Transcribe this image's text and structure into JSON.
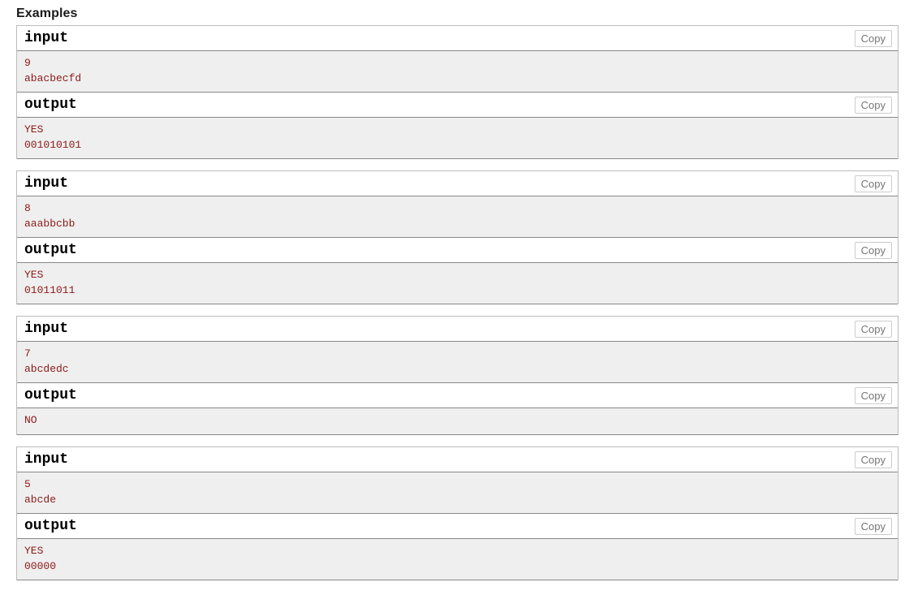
{
  "section": {
    "title": "Examples"
  },
  "labels": {
    "input": "input",
    "output": "output",
    "copy": "Copy"
  },
  "colors": {
    "sample_text": "#8b1a18",
    "sample_background": "#efefef",
    "border": "#bbbbbb",
    "separator": "#888888",
    "copy_button_text": "#767676",
    "copy_button_border": "#cccccc",
    "page_background": "#ffffff",
    "heading_text": "#1b1b1b"
  },
  "examples": [
    {
      "input_label": "input",
      "input_copy": "Copy",
      "input_text": "9\nabacbecfd",
      "output_label": "output",
      "output_copy": "Copy",
      "output_text": "YES\n001010101"
    },
    {
      "input_label": "input",
      "input_copy": "Copy",
      "input_text": "8\naaabbcbb",
      "output_label": "output",
      "output_copy": "Copy",
      "output_text": "YES\n01011011"
    },
    {
      "input_label": "input",
      "input_copy": "Copy",
      "input_text": "7\nabcdedc",
      "output_label": "output",
      "output_copy": "Copy",
      "output_text": "NO"
    },
    {
      "input_label": "input",
      "input_copy": "Copy",
      "input_text": "5\nabcde",
      "output_label": "output",
      "output_copy": "Copy",
      "output_text": "YES\n00000"
    }
  ]
}
